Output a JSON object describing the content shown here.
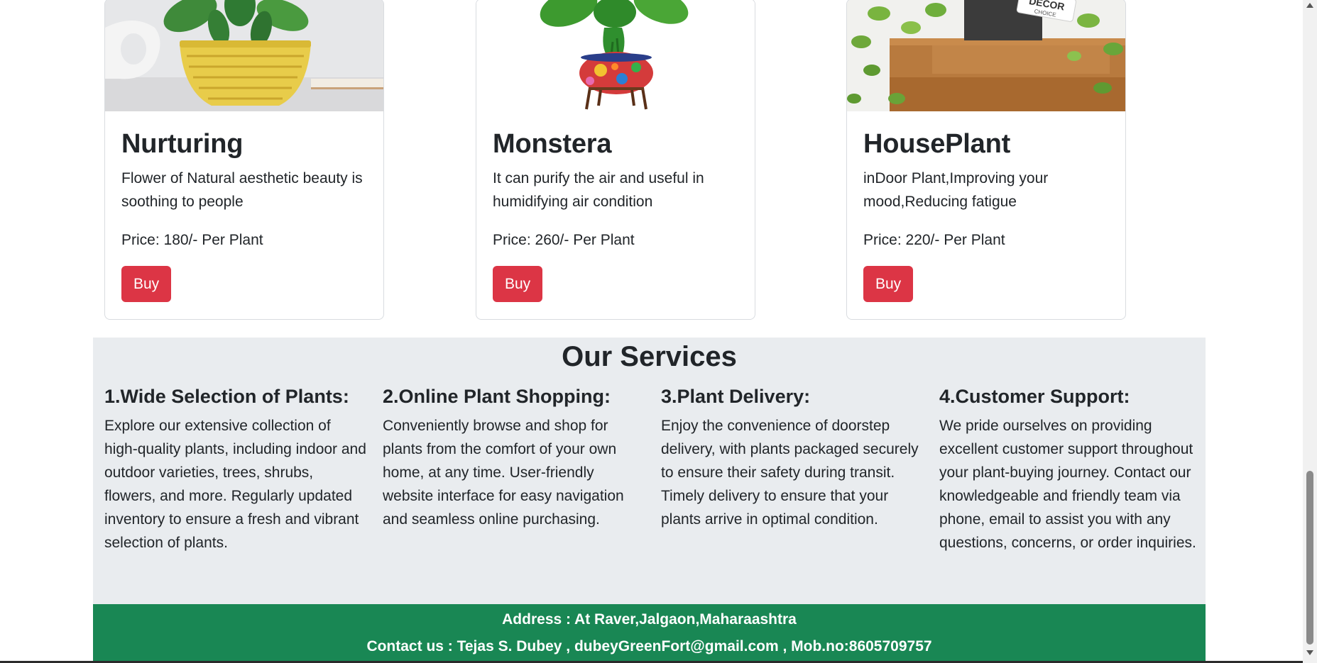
{
  "products": [
    {
      "name": "Nurturing",
      "description": "Flower of Natural aesthetic beauty is soothing to people",
      "price": "Price: 180/- Per Plant",
      "buy_label": "Buy",
      "image_icon": "potted-plant-yellow-basket-image"
    },
    {
      "name": "Monstera",
      "description": "It can purify the air and useful in humidifying air condition",
      "price": "Price: 260/- Per Plant",
      "buy_label": "Buy",
      "image_icon": "monstera-colorful-pot-image"
    },
    {
      "name": "HousePlant",
      "description": "inDoor Plant,Improving your mood,Reducing fatigue",
      "price": "Price: 220/- Per Plant",
      "buy_label": "Buy",
      "image_icon": "hanging-houseplant-image",
      "image_tag_line1": "DECOR",
      "image_tag_line2": "CHOICE"
    }
  ],
  "services": {
    "heading": "Our Services",
    "items": [
      {
        "title": "1.Wide Selection of Plants:",
        "text": "Explore our extensive collection of high-quality plants, including indoor and outdoor varieties, trees, shrubs, flowers, and more. Regularly updated inventory to ensure a fresh and vibrant selection of plants."
      },
      {
        "title": "2.Online Plant Shopping:",
        "text": "Conveniently browse and shop for plants from the comfort of your own home, at any time. User-friendly website interface for easy navigation and seamless online purchasing."
      },
      {
        "title": "3.Plant Delivery:",
        "text": "Enjoy the convenience of doorstep delivery, with plants packaged securely to ensure their safety during transit. Timely delivery to ensure that your plants arrive in optimal condition."
      },
      {
        "title": "4.Customer Support:",
        "text": "We pride ourselves on providing excellent customer support throughout your plant-buying journey. Contact our knowledgeable and friendly team via phone, email to assist you with any questions, concerns, or order inquiries."
      }
    ]
  },
  "footer": {
    "address": "Address : At Raver,Jalgaon,Maharaashtra",
    "contact": "Contact us : Tejas S. Dubey , dubeyGreenFort@gmail.com , Mob.no:8605709757"
  },
  "colors": {
    "buy_button": "#dc3545",
    "services_bg": "#e9ecef",
    "footer_bg": "#198754"
  }
}
